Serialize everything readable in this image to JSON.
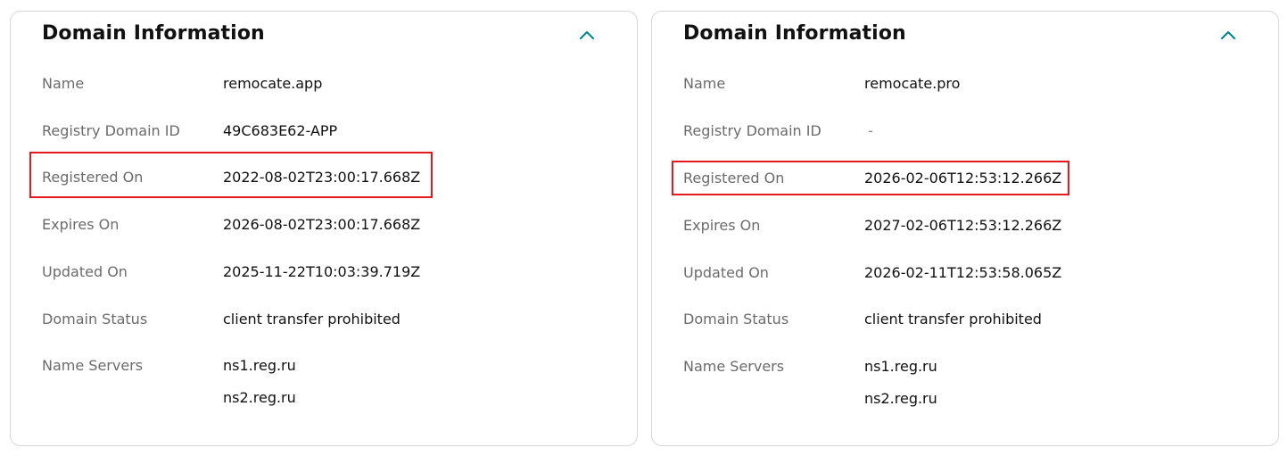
{
  "cards": [
    {
      "title": "Domain Information",
      "rows": {
        "name": {
          "label": "Name",
          "value": "remocate.app"
        },
        "registry_id": {
          "label": "Registry Domain ID",
          "value": "49C683E62-APP"
        },
        "registered_on": {
          "label": "Registered On",
          "value": "2022-08-02T23:00:17.668Z"
        },
        "expires_on": {
          "label": "Expires On",
          "value": "2026-08-02T23:00:17.668Z"
        },
        "updated_on": {
          "label": "Updated On",
          "value": "2025-11-22T10:03:39.719Z"
        },
        "status": {
          "label": "Domain Status",
          "value": "client transfer prohibited"
        },
        "name_servers": {
          "label": "Name Servers",
          "values": [
            "ns1.reg.ru",
            "ns2.reg.ru"
          ]
        }
      }
    },
    {
      "title": "Domain Information",
      "rows": {
        "name": {
          "label": "Name",
          "value": "remocate.pro"
        },
        "registry_id": {
          "label": "Registry Domain ID",
          "value": "-"
        },
        "registered_on": {
          "label": "Registered On",
          "value": "2026-02-06T12:53:12.266Z"
        },
        "expires_on": {
          "label": "Expires On",
          "value": "2027-02-06T12:53:12.266Z"
        },
        "updated_on": {
          "label": "Updated On",
          "value": "2026-02-11T12:53:58.065Z"
        },
        "status": {
          "label": "Domain Status",
          "value": "client transfer prohibited"
        },
        "name_servers": {
          "label": "Name Servers",
          "values": [
            "ns1.reg.ru",
            "ns2.reg.ru"
          ]
        }
      }
    }
  ],
  "icons": {
    "collapse": "chevron-up-icon"
  },
  "colors": {
    "accent": "#00838c",
    "highlight": "#e3191c",
    "label": "#6b6b6b",
    "value": "#111111"
  }
}
